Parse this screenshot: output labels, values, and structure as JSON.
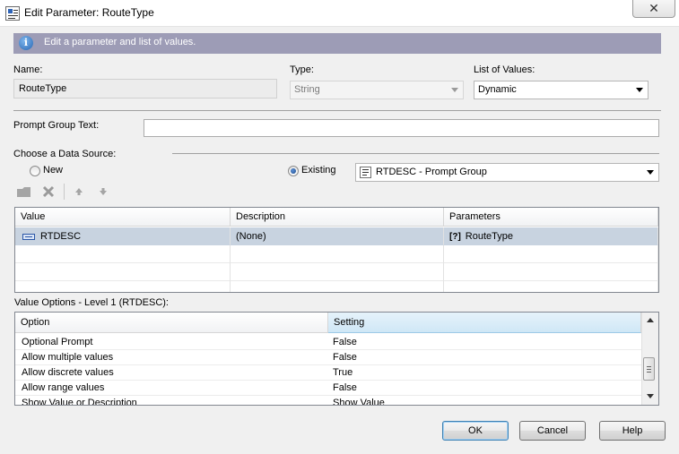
{
  "window": {
    "title": "Edit Parameter: RouteType",
    "close_glyph": "✕"
  },
  "banner": {
    "text": "Edit a parameter and list of values."
  },
  "fields": {
    "name_label": "Name:",
    "name_value": "RouteType",
    "type_label": "Type:",
    "type_value": "String",
    "lov_label": "List of Values:",
    "lov_value": "Dynamic",
    "prompt_group_label": "Prompt Group Text:",
    "prompt_group_value": "",
    "datasource_label": "Choose a Data Source:",
    "new_label": "New",
    "existing_label": "Existing",
    "new_selected": false,
    "existing_selected": true,
    "existing_value": "RTDESC - Prompt Group"
  },
  "toolbar": {
    "icons": [
      "open-icon",
      "delete-icon",
      "move-up-icon",
      "move-down-icon"
    ]
  },
  "values_table": {
    "headers": [
      "Value",
      "Description",
      "Parameters"
    ],
    "rows": [
      {
        "value": "RTDESC",
        "description": "(None)",
        "parameters": "RouteType",
        "param_badge": "[?]"
      }
    ]
  },
  "value_options": {
    "title": "Value Options - Level 1 (RTDESC):",
    "headers": [
      "Option",
      "Setting"
    ],
    "rows": [
      {
        "option": "Optional Prompt",
        "setting": "False"
      },
      {
        "option": "Allow multiple values",
        "setting": "False"
      },
      {
        "option": "Allow discrete values",
        "setting": "True"
      },
      {
        "option": "Allow range values",
        "setting": "False"
      },
      {
        "option": "Show Value or Description",
        "setting": "Show Value"
      }
    ]
  },
  "buttons": {
    "ok": "OK",
    "cancel": "Cancel",
    "help": "Help"
  },
  "colors": {
    "banner": "#9d9cb6",
    "selected_row": "#c8d3e0",
    "setting_header": "#d9ecf8"
  }
}
